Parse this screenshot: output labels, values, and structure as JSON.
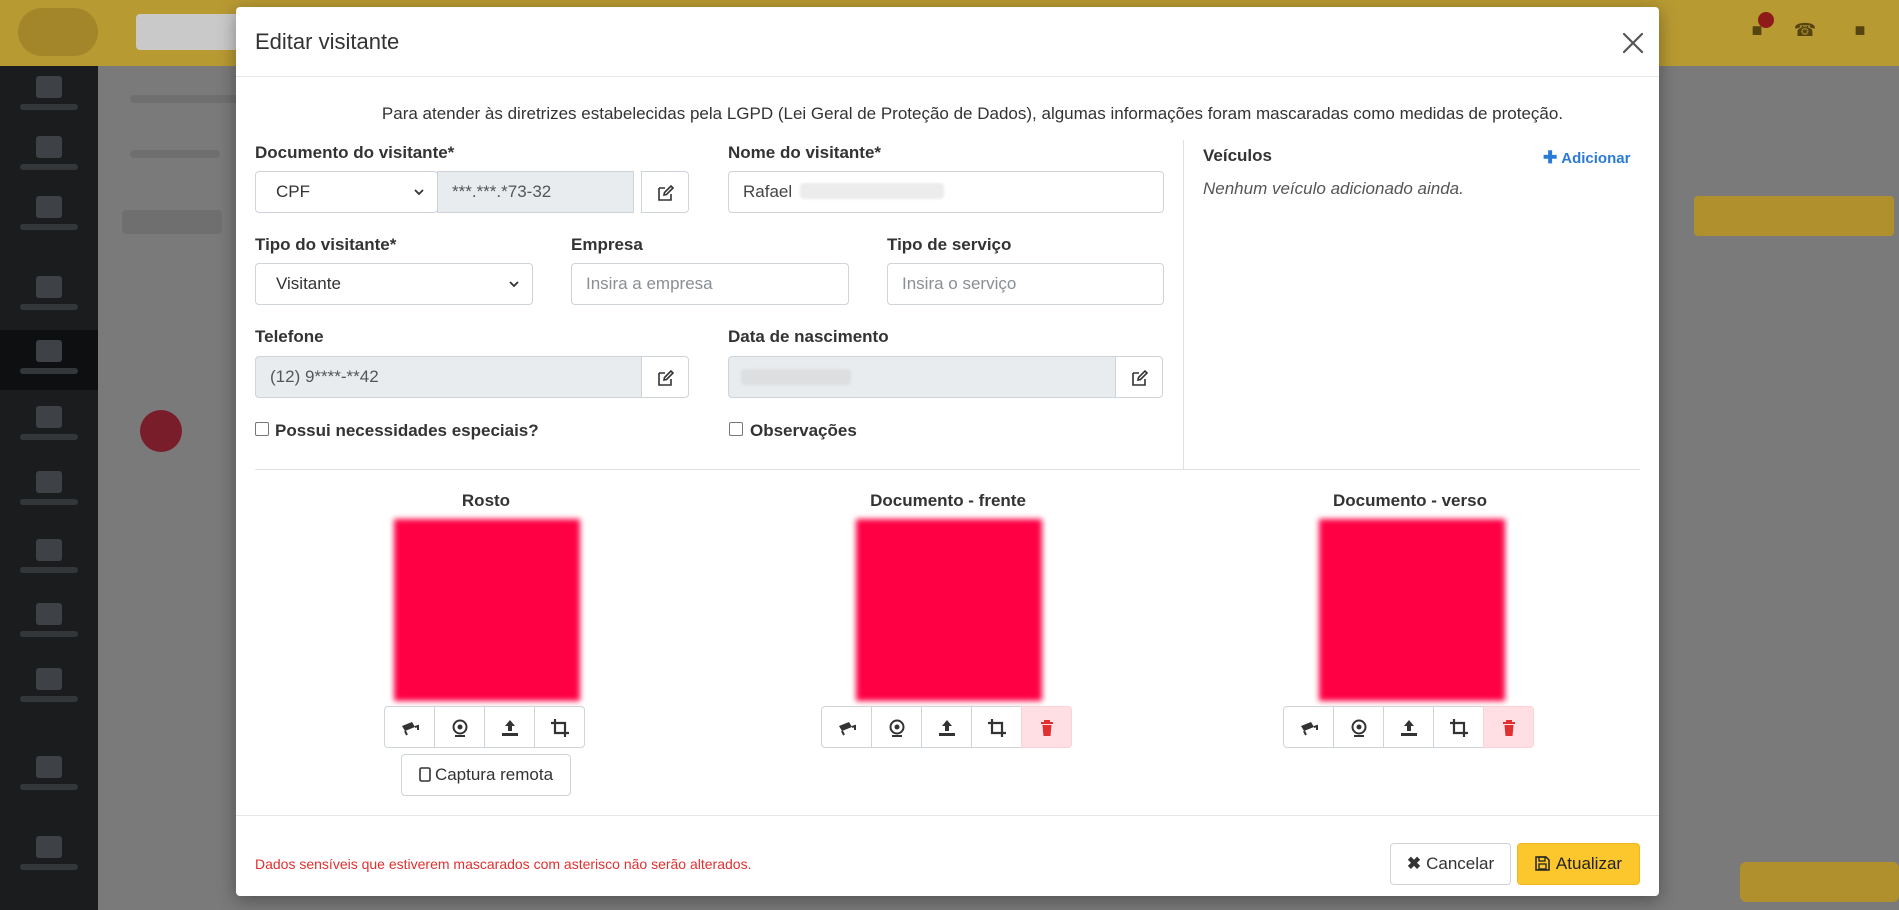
{
  "modal": {
    "title": "Editar visitante",
    "notice": "Para atender às diretrizes estabelecidas pela LGPD (Lei Geral de Proteção de Dados), algumas informações foram mascaradas como medidas de proteção."
  },
  "form": {
    "documento_label": "Documento do visitante*",
    "documento_tipo": "CPF",
    "documento_valor": "***.***.*73-32",
    "nome_label": "Nome do visitante*",
    "nome_valor": "Rafael",
    "tipo_visitante_label": "Tipo do visitante*",
    "tipo_visitante_valor": "Visitante",
    "empresa_label": "Empresa",
    "empresa_placeholder": "Insira a empresa",
    "tipo_servico_label": "Tipo de serviço",
    "tipo_servico_placeholder": "Insira o serviço",
    "telefone_label": "Telefone",
    "telefone_valor": "(12) 9****-**42",
    "data_nascimento_label": "Data de nascimento",
    "necessidades_label": "Possui necessidades especiais?",
    "observacoes_label": "Observações"
  },
  "veiculos": {
    "title": "Veículos",
    "add_label": "Adicionar",
    "empty": "Nenhum veículo adicionado ainda."
  },
  "photos": {
    "rosto": "Rosto",
    "frente": "Documento - frente",
    "verso": "Documento - verso",
    "remote_capture": "Captura remota"
  },
  "footer": {
    "note": "Dados sensíveis que estiverem mascarados com asterisco não serão alterados.",
    "cancel": "Cancelar",
    "update": "Atualizar"
  },
  "colors": {
    "accent": "#fcc72c",
    "danger": "#e0302f",
    "link": "#2a7bd6",
    "photo_placeholder": "#ff0044"
  }
}
